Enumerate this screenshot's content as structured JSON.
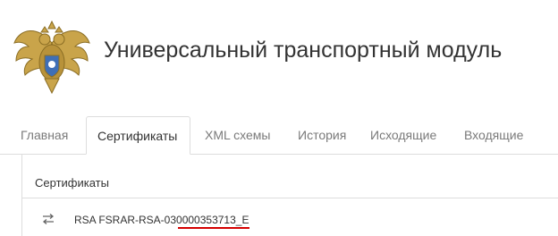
{
  "header": {
    "title": "Универсальный транспортный модуль",
    "logo_icon": "double-headed-eagle-emblem"
  },
  "tabs": [
    {
      "label": "Главная",
      "active": false
    },
    {
      "label": "Сертификаты",
      "active": true
    },
    {
      "label": "XML схемы",
      "active": false
    },
    {
      "label": "История",
      "active": false
    },
    {
      "label": "Исходящие",
      "active": false
    },
    {
      "label": "Входящие",
      "active": false
    }
  ],
  "panel": {
    "title": "Сертификаты",
    "certificate": {
      "icon": "swap-arrows-icon",
      "label": "RSA FSRAR-RSA-030000353713_E",
      "highlight_color": "#d40000"
    }
  },
  "colors": {
    "text": "#333333",
    "muted": "#7a7a7a",
    "border": "#dddddd",
    "emblem_gold": "#c9a44a"
  }
}
